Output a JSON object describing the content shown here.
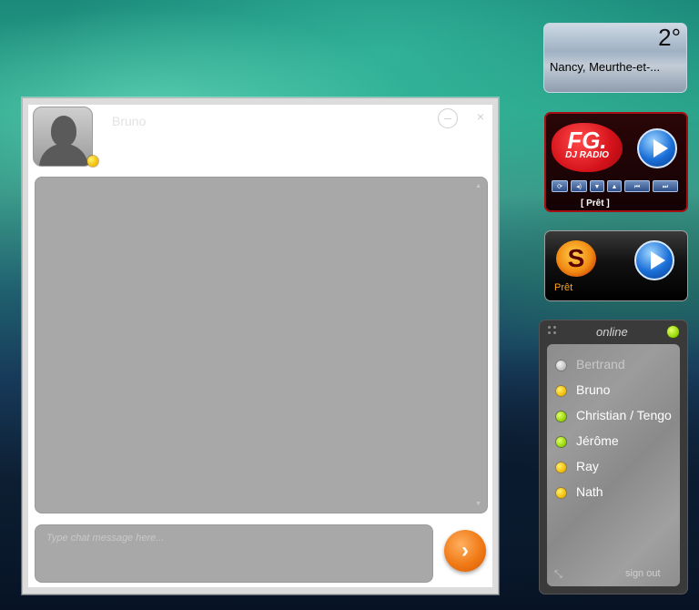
{
  "chat": {
    "contact_name": "Bruno",
    "contact_status": "yellow",
    "minimize_symbol": "–",
    "close_symbol": "×",
    "input_placeholder": "Type chat message here...",
    "send_symbol": "›",
    "scroll_up": "▲",
    "scroll_down": "▼"
  },
  "weather": {
    "temperature": "2°",
    "location": "Nancy, Meurthe-et-..."
  },
  "radio_fg": {
    "logo_main": "FG.",
    "logo_sub": "DJ RADIO",
    "status": "[ Prêt ]",
    "controls": [
      "⟳",
      "◂)",
      "▼",
      "▲",
      "⏮",
      "⏭"
    ]
  },
  "radio_sl": {
    "logo": "S",
    "status": "Prêt"
  },
  "contacts": {
    "header_label": "online",
    "own_status": "green",
    "items": [
      {
        "name": "Bertrand",
        "status": "offline"
      },
      {
        "name": "Bruno",
        "status": "away"
      },
      {
        "name": "Christian / Tengo",
        "status": "online"
      },
      {
        "name": "Jérôme",
        "status": "online"
      },
      {
        "name": "Ray",
        "status": "away"
      },
      {
        "name": "Nath",
        "status": "away"
      }
    ],
    "resize_symbol": "⤡",
    "signout_label": "sign out"
  },
  "colors": {
    "away": "#f0b800",
    "online": "#8fd400",
    "offline": "#bdbdbd",
    "send_button": "#f07a16",
    "fg_brand": "#d5121b",
    "sl_status": "#ffa21e"
  }
}
